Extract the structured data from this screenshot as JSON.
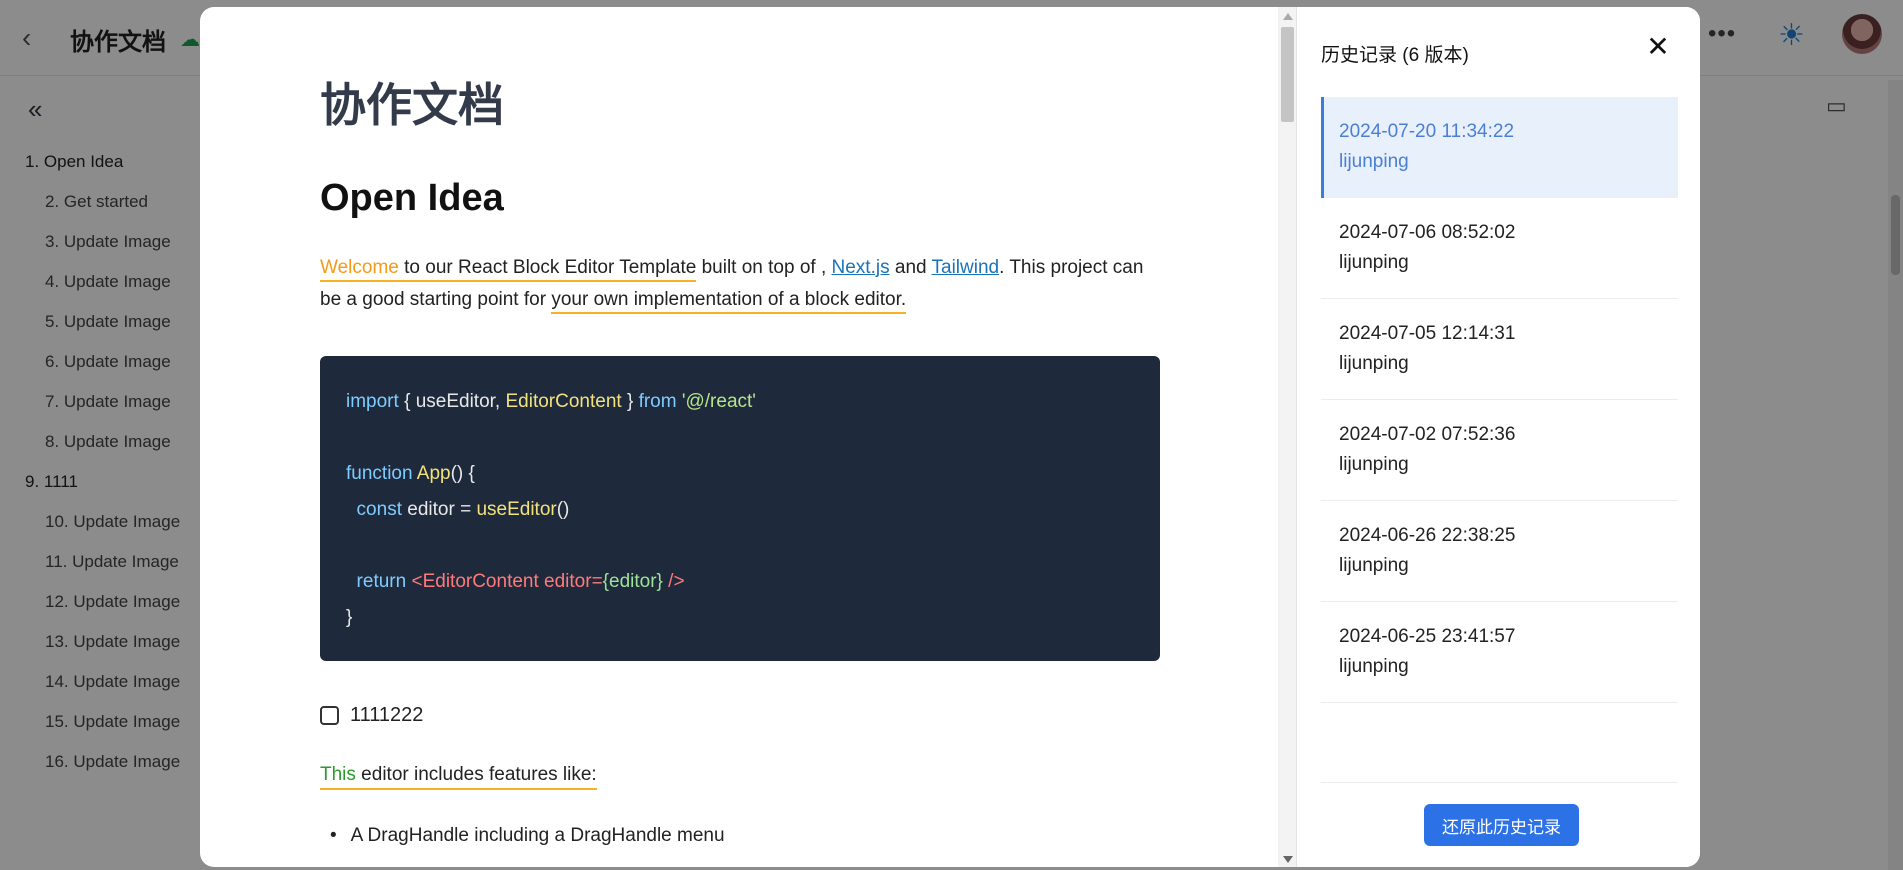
{
  "app": {
    "title": "协作文档",
    "back_icon": "‹",
    "cloud_icon": "☁",
    "more_icon": "•••",
    "theme_icon": "☀",
    "collapse_icon": "«",
    "comment_icon": "▭"
  },
  "outline": [
    {
      "label": "1. Open Idea",
      "level": 1
    },
    {
      "label": "2. Get started",
      "level": 2
    },
    {
      "label": "3. Update Image",
      "level": 2
    },
    {
      "label": "4. Update Image",
      "level": 2
    },
    {
      "label": "5. Update Image",
      "level": 2
    },
    {
      "label": "6. Update Image",
      "level": 2
    },
    {
      "label": "7. Update Image",
      "level": 2
    },
    {
      "label": "8. Update Image",
      "level": 2
    },
    {
      "label": "9. 1111",
      "level": 1
    },
    {
      "label": "10. Update Image",
      "level": 2
    },
    {
      "label": "11. Update Image",
      "level": 2
    },
    {
      "label": "12. Update Image",
      "level": 2
    },
    {
      "label": "13. Update Image",
      "level": 2
    },
    {
      "label": "14. Update Image",
      "level": 2
    },
    {
      "label": "15. Update Image",
      "level": 2
    },
    {
      "label": "16. Update Image",
      "level": 2
    }
  ],
  "document": {
    "title": "协作文档",
    "heading": "Open Idea",
    "intro": {
      "welcome": "Welcome",
      "part1": " to our React Block Editor Template",
      "part2": " built on top of , ",
      "link1": "Next.js",
      "and": " and ",
      "link2": "Tailwind",
      "part3": ". This project can be a good starting point for ",
      "highlight": "your own implementation of a block editor."
    },
    "code": {
      "l1_import": "import",
      "l1_mid": " { useEditor, ",
      "l1_ec": "EditorContent",
      "l1_end": " } ",
      "l1_from": "from",
      "l1_str": " '@/react'",
      "l2_function": "function",
      "l2_name": " App",
      "l2_end": "() {",
      "l3_const": "  const",
      "l3_mid": " editor = ",
      "l3_fn": "useEditor",
      "l3_end": "()",
      "l4_return": "  return",
      "l4_tag": " <EditorContent editor=",
      "l4_val": "{editor}",
      "l4_close": " />",
      "l5": "}"
    },
    "task_label": "1111222",
    "features": {
      "this": "This",
      "rest": " editor includes features like:"
    },
    "bullet1": "A DragHandle including a DragHandle menu"
  },
  "history": {
    "title": "历史记录 (6 版本)",
    "close_icon": "✕",
    "items": [
      {
        "time": "2024-07-20 11:34:22",
        "user": "lijunping",
        "active": true
      },
      {
        "time": "2024-07-06 08:52:02",
        "user": "lijunping",
        "active": false
      },
      {
        "time": "2024-07-05 12:14:31",
        "user": "lijunping",
        "active": false
      },
      {
        "time": "2024-07-02 07:52:36",
        "user": "lijunping",
        "active": false
      },
      {
        "time": "2024-06-26 22:38:25",
        "user": "lijunping",
        "active": false
      },
      {
        "time": "2024-06-25 23:41:57",
        "user": "lijunping",
        "active": false
      }
    ],
    "restore_label": "还原此历史记录"
  },
  "colors": {
    "accent": "#2c72e6",
    "active_bg": "#e8f0fc",
    "code_bg": "#1e293b",
    "highlight_underline": "#f5b324"
  }
}
